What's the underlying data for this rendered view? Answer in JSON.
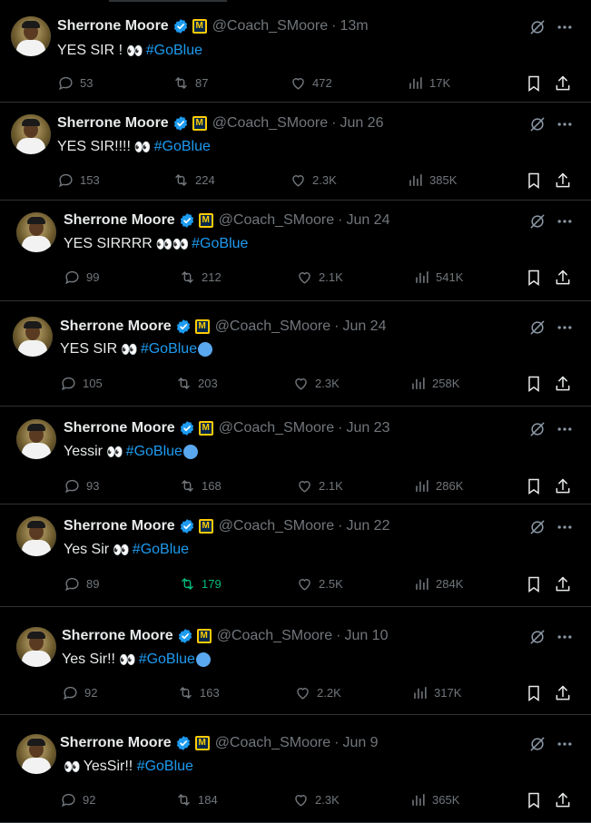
{
  "author": {
    "name": "Sherrone Moore",
    "handle": "@Coach_SMoore",
    "affiliation_badge": "M"
  },
  "tweets": [
    {
      "time": "13m",
      "text_pre": "YES SIR !",
      "eyes": "👀",
      "hashtag": "#GoBlue",
      "blue_dot": false,
      "replies": "53",
      "retweets": "87",
      "likes": "472",
      "views": "17K",
      "retweet_active": false
    },
    {
      "time": "Jun 26",
      "text_pre": "YES SIR!!!!",
      "eyes": "👀",
      "hashtag": "#GoBlue",
      "blue_dot": false,
      "replies": "153",
      "retweets": "224",
      "likes": "2.3K",
      "views": "385K",
      "retweet_active": false
    },
    {
      "time": "Jun 24",
      "text_pre": "YES SIRRRR",
      "eyes": "👀👀",
      "hashtag": "#GoBlue",
      "blue_dot": false,
      "replies": "99",
      "retweets": "212",
      "likes": "2.1K",
      "views": "541K",
      "retweet_active": false
    },
    {
      "time": "Jun 24",
      "text_pre": "YES SIR",
      "eyes": "👀",
      "hashtag": "#GoBlue",
      "blue_dot": true,
      "replies": "105",
      "retweets": "203",
      "likes": "2.3K",
      "views": "258K",
      "retweet_active": false
    },
    {
      "time": "Jun 23",
      "text_pre": "Yessir",
      "eyes": "👀",
      "hashtag": "#GoBlue",
      "blue_dot": true,
      "replies": "93",
      "retweets": "168",
      "likes": "2.1K",
      "views": "286K",
      "retweet_active": false
    },
    {
      "time": "Jun 22",
      "text_pre": "Yes Sir",
      "eyes": "👀",
      "hashtag": "#GoBlue",
      "blue_dot": false,
      "replies": "89",
      "retweets": "179",
      "likes": "2.5K",
      "views": "284K",
      "retweet_active": true
    },
    {
      "time": "Jun 10",
      "text_pre": "Yes Sir!!",
      "eyes": "👀",
      "hashtag": "#GoBlue",
      "blue_dot": true,
      "replies": "92",
      "retweets": "163",
      "likes": "2.2K",
      "views": "317K",
      "retweet_active": false
    },
    {
      "time": "Jun 9",
      "text_pre": "YesSir!!",
      "eyes": "👀",
      "eyes_first": true,
      "hashtag": "#GoBlue",
      "blue_dot": false,
      "replies": "92",
      "retweets": "184",
      "likes": "2.3K",
      "views": "365K",
      "retweet_active": false
    }
  ],
  "icons": {
    "reply": "reply-icon",
    "retweet": "retweet-icon",
    "like": "heart-icon",
    "views": "analytics-icon",
    "bookmark": "bookmark-icon",
    "share": "share-icon",
    "grok": "grok-icon",
    "more": "more-icon",
    "verified": "verified-badge-icon"
  },
  "colors": {
    "background": "#000000",
    "text": "#e7e9ea",
    "muted": "#71767b",
    "link": "#1d9bf0",
    "retweet_active": "#00ba7c",
    "divider": "#2f3336",
    "verified": "#1d9bf0",
    "affiliation": "#ffcb05"
  }
}
